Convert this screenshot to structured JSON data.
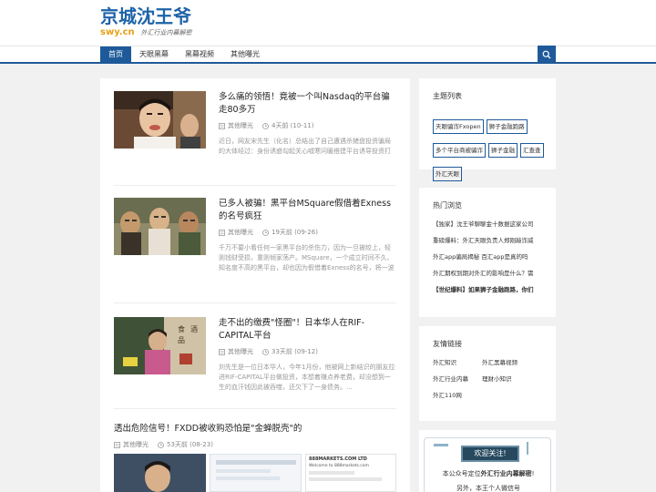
{
  "site": {
    "logo_main": "京城沈王爷",
    "logo_domain": "swy.cn",
    "logo_slogan": "外汇行业内幕解密"
  },
  "nav": {
    "items": [
      "首页",
      "天眼黑幕",
      "黑幕视频",
      "其他曝光"
    ],
    "active_index": 0,
    "search_icon": "search-icon"
  },
  "articles": [
    {
      "title": "多么痛的领悟！竟被一个叫Nasdaq的平台骗走80多万",
      "category": "其他曝光",
      "time": "4天前 (10-11)",
      "excerpt": "近日，网友宋先生（化名）总结出了自己遭遇杀猪盘投资骗局的大体经过：身份诱惑勾起关心嘘寒问暖搭建平台诱导投资打情骂俏套着与其无法提现当你再也拿不出钱的时候，最后反咬..."
    },
    {
      "title": "已多人被骗！黑平台MSquare假借着Exness的名号疯狂",
      "category": "其他曝光",
      "time": "19天前 (09-26)",
      "excerpt": "千万不要小看任何一家黑平台的杀伤力，因为一旦被绞上，轻则钱财受损，重则倾家荡产。MSquare，一个成立时间不久、知名度不高的黑平台，却也因为假借着Exness的名号，将一波又一..."
    },
    {
      "title": "走不出的缴费\"怪圈\"！日本华人在RIF-CAPITAL平台",
      "category": "其他曝光",
      "time": "33天前 (09-12)",
      "excerpt": "刘先生是一位日本华人，今年1月份，他被网上新结识的朋友拉进RIF-CAPITAL平台做投资，本想着赚点养老费，却没想到一生的血汗钱因此被吞噬，还欠下了一身债务。..."
    },
    {
      "title": "透出危险信号！FXDD被收购恐怕是\"金蝉脱壳\"的",
      "category": "其他曝光",
      "time": "53天前 (08-23)",
      "excerpt": ""
    }
  ],
  "sidebar": {
    "topics_title": "主题列表",
    "topics": [
      "天眼骗诈Fxopen",
      "狮子金融跑路",
      "多个平台商被骗诈",
      "狮子金融",
      "汇查查",
      "外汇天眼"
    ],
    "hot_title": "热门浏览",
    "hot_items": [
      "【独家】沈王爷聊聊金十数据这家公司",
      "重磅爆料：外汇天眼负责人郑刚敲诈威",
      "外汇app骗局揭秘 百汇app是真的吗",
      "外汇期权到期对外汇的影响是什么？需",
      "【世纪爆料】如果狮子金融跑路，你们"
    ],
    "links_title": "友情链接",
    "links": [
      "外汇知识",
      "外汇黑幕视频",
      "外汇行业内幕",
      "理财小知识",
      "外汇110网"
    ],
    "card": {
      "board_text": "欢迎关注!",
      "line1_prefix": "本公众号定位",
      "line1_emph": "外汇行业内幕解密",
      "line1_suffix": "!",
      "line2": "另外，本王个人微信号"
    }
  },
  "thumb_extra": {
    "ad_domain": "888MARKETS.COM LTD",
    "ad_line": "Welcome to 888markets.com"
  }
}
